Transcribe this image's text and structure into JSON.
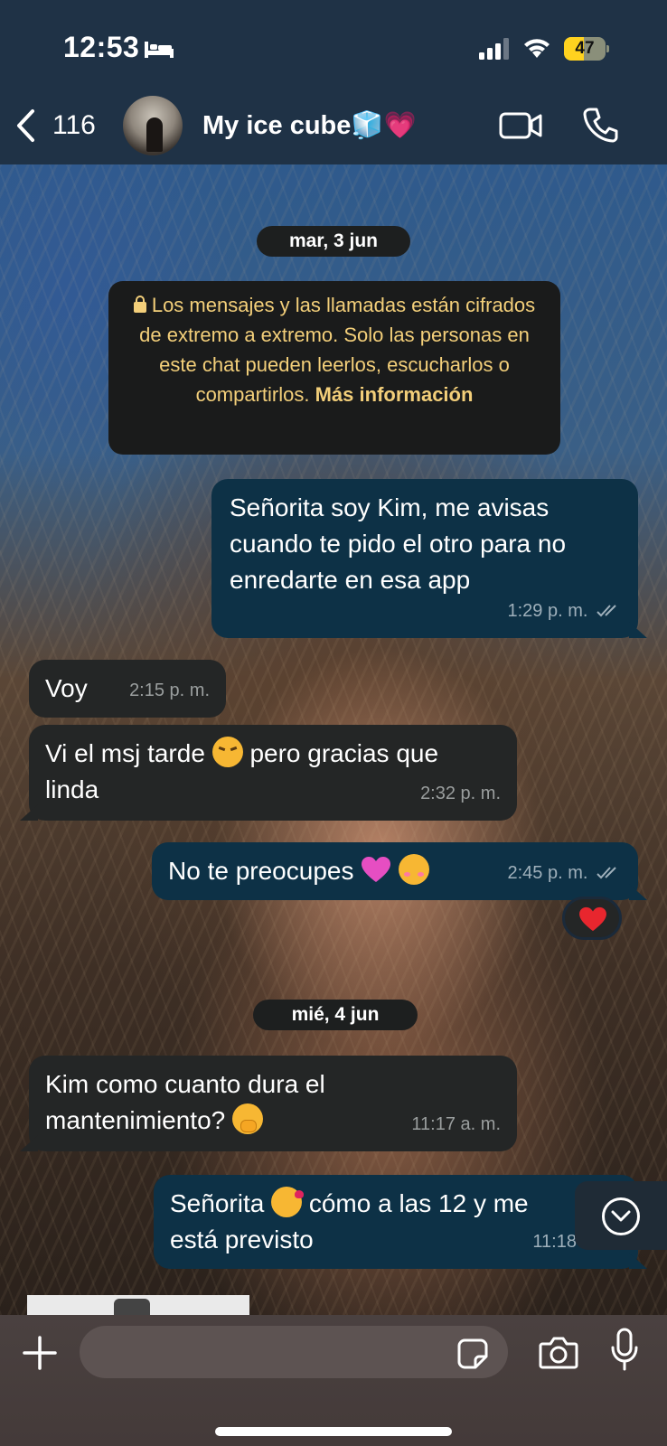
{
  "status_bar": {
    "time": "12:53",
    "battery": "47",
    "battery_level": 0.47
  },
  "header": {
    "back_count": "116",
    "contact_name": "My ice cube🧊💗"
  },
  "chat": {
    "date_1": "mar, 3 jun",
    "encryption_notice": "Los mensajes y las llamadas están cifrados de extremo a extremo. Solo las personas en este chat pueden leerlos, escucharlos o compartirlos.",
    "encryption_more": "Más información",
    "msg1": {
      "text": "Señorita soy Kim, me avisas cuando te pido el otro para no enredarte en esa app",
      "time": "1:29 p. m."
    },
    "msg2": {
      "text": "Voy",
      "time": "2:15 p. m."
    },
    "msg3": {
      "text_a": "Vi el msj tarde",
      "text_b": "pero gracias que linda",
      "time": "2:32 p. m."
    },
    "msg4": {
      "text": "No te preocupes",
      "time": "2:45 p. m.",
      "reaction": "heart"
    },
    "date_2": "mié, 4 jun",
    "msg5": {
      "text": "Kim como cuanto dura el mantenimiento?",
      "time": "11:17 a. m."
    },
    "msg6": {
      "text_a": "Señorita",
      "text_b": "cómo a las 12 y me",
      "text_c": "está previsto",
      "time": "11:18 a. m."
    }
  },
  "composer": {
    "placeholder": ""
  },
  "colors": {
    "outgoing": "#0d3146",
    "incoming": "#242626",
    "notice_text": "#f3cf7a",
    "battery": "#ffd21f"
  },
  "icons": [
    "bed-icon",
    "signal-icon",
    "wifi-icon",
    "back-icon",
    "video-icon",
    "phone-icon",
    "lock-icon",
    "double-check-icon",
    "heart-icon",
    "chevron-down-icon",
    "plus-icon",
    "sticker-icon",
    "camera-icon",
    "mic-icon"
  ]
}
